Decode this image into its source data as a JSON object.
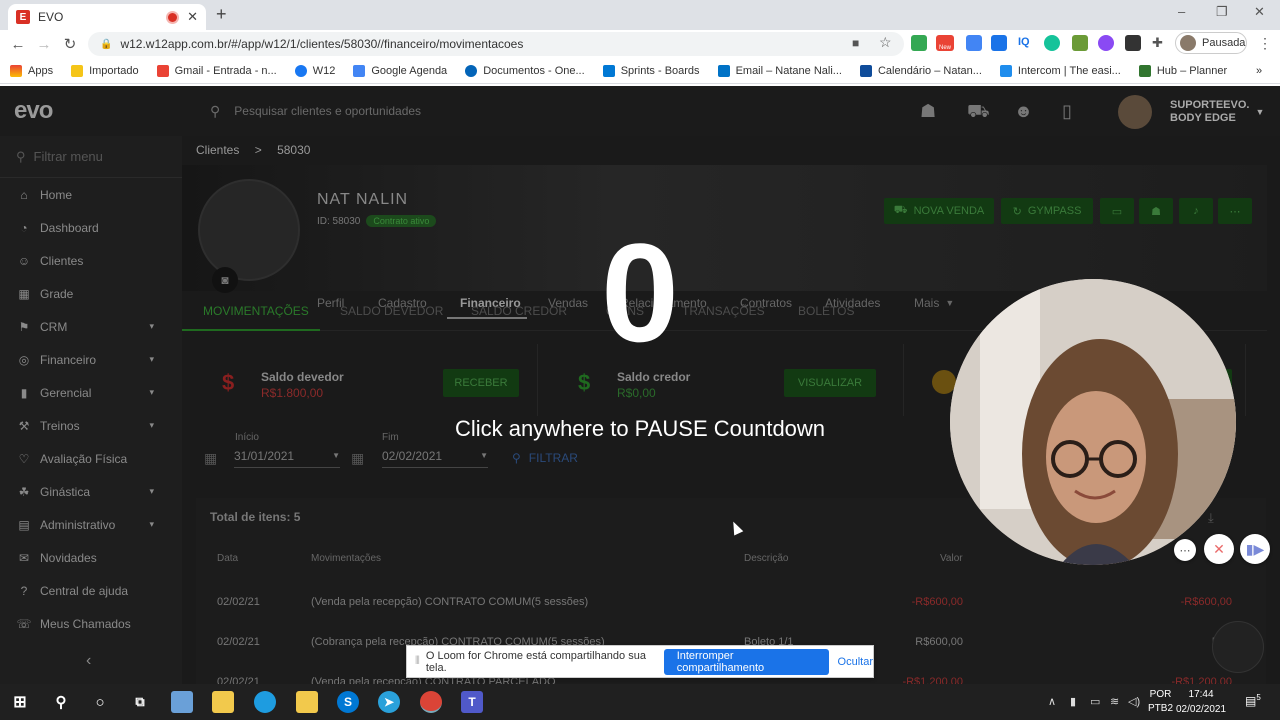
{
  "browser": {
    "tab_title": "EVO",
    "tab_icon_letter": "E",
    "new_tab": "+",
    "window_controls": [
      "–",
      "❐",
      "✕"
    ],
    "url": "w12.w12app.com.br/#/app/w12/1/clientes/58030//financeiro/movimentacoes",
    "profile_label": "Pausada",
    "extension_new_badge": "New",
    "extension_iq": "IQ",
    "bookmarks": [
      "Apps",
      "Importado",
      "Gmail - Entrada - n...",
      "W12",
      "Google Agenda",
      "Documentos - One...",
      "Sprints - Boards",
      "Email – Natane Nali...",
      "Calendário – Natan...",
      "Intercom | The easi...",
      "Hub – Planner"
    ],
    "bookmark_more": "»"
  },
  "app": {
    "logo": "evo",
    "search_placeholder": "Pesquisar clientes e oportunidades",
    "user_line1": "SUPORTEEVO.",
    "user_line2": "BODY EDGE",
    "sidebar_filter_placeholder": "Filtrar menu",
    "sidebar": [
      {
        "label": "Home",
        "icon": "home-icon",
        "glyph": "⌂",
        "chevron": false
      },
      {
        "label": "Dashboard",
        "icon": "dashboard-icon",
        "glyph": "◔",
        "chevron": false
      },
      {
        "label": "Clientes",
        "icon": "clients-icon",
        "glyph": "☺",
        "chevron": false
      },
      {
        "label": "Grade",
        "icon": "calendar-icon",
        "glyph": "▦",
        "chevron": false
      },
      {
        "label": "CRM",
        "icon": "crm-icon",
        "glyph": "⚑",
        "chevron": true
      },
      {
        "label": "Financeiro",
        "icon": "finance-icon",
        "glyph": "◎",
        "chevron": true
      },
      {
        "label": "Gerencial",
        "icon": "chart-icon",
        "glyph": "▮",
        "chevron": true
      },
      {
        "label": "Treinos",
        "icon": "dumbbell-icon",
        "glyph": "⚒",
        "chevron": true
      },
      {
        "label": "Avaliação Física",
        "icon": "heart-icon",
        "glyph": "♡",
        "chevron": false
      },
      {
        "label": "Ginástica",
        "icon": "gym-icon",
        "glyph": "☘",
        "chevron": true
      },
      {
        "label": "Administrativo",
        "icon": "admin-icon",
        "glyph": "▤",
        "chevron": true
      },
      {
        "label": "Novidades",
        "icon": "news-icon",
        "glyph": "✉",
        "chevron": false
      },
      {
        "label": "Central de ajuda",
        "icon": "help-icon",
        "glyph": "?",
        "chevron": false
      },
      {
        "label": "Meus Chamados",
        "icon": "tickets-icon",
        "glyph": "☏",
        "chevron": false
      }
    ],
    "sidebar_collapse": "‹",
    "breadcrumb": {
      "root": "Clientes",
      "sep": ">",
      "current": "58030"
    },
    "client": {
      "name": "NAT NALIN",
      "id_label": "ID: 58030",
      "status": "Contrato ativo"
    },
    "hero_buttons": {
      "nova_venda": "NOVA VENDA",
      "gympass": "GYMPASS"
    },
    "subtabs": [
      "Perfil",
      "Cadastro",
      "Financeiro",
      "Vendas",
      "Relacionamento",
      "Contratos",
      "Atividades",
      "Mais"
    ],
    "fin_tabs": [
      "MOVIMENTAÇÕES",
      "SALDO DEVEDOR",
      "SALDO CREDOR",
      "COINS",
      "TRANSAÇÕES",
      "BOLETOS"
    ],
    "cards": [
      {
        "label": "Saldo devedor",
        "value": "R$1.800,00",
        "button": "RECEBER",
        "color": "#8a1f1f"
      },
      {
        "label": "Saldo credor",
        "value": "R$0,00",
        "button": "VISUALIZAR",
        "color": "#1f6a1f"
      }
    ],
    "filters": {
      "start_label": "Início",
      "start_value": "31/01/2021",
      "end_label": "Fim",
      "end_value": "02/02/2021",
      "button": "FILTRAR"
    },
    "table": {
      "total": "Total de itens: 5",
      "headers": [
        "Data",
        "Movimentações",
        "Descrição",
        "Valor"
      ],
      "rows": [
        {
          "date": "02/02/21",
          "mov": "(Venda pela recepção) CONTRATO COMUM(5 sessões)",
          "desc": "",
          "value": "-R$600,00",
          "total": "-R$600,00"
        },
        {
          "date": "02/02/21",
          "mov": "(Cobrança pela recepção) CONTRATO COMUM(5 sessões)",
          "desc": "Boleto 1/1",
          "value": "R$600,00",
          "total": "R$0"
        },
        {
          "date": "02/02/21",
          "mov": "(Venda pela recepção) CONTRATO PARCELADO",
          "desc": "",
          "value": "-R$1.200,00",
          "total": "-R$1.200,00"
        }
      ]
    }
  },
  "overlay": {
    "countdown": "0",
    "pause_text": "Click anywhere to PAUSE Countdown",
    "share_message": "O Loom for Chrome está compartilhando sua tela.",
    "stop_sharing": "Interromper compartilhamento",
    "hide": "Ocultar"
  },
  "taskbar": {
    "language": "POR",
    "layout": "PTB2",
    "time": "17:44",
    "date": "02/02/2021",
    "notifications": "5"
  }
}
